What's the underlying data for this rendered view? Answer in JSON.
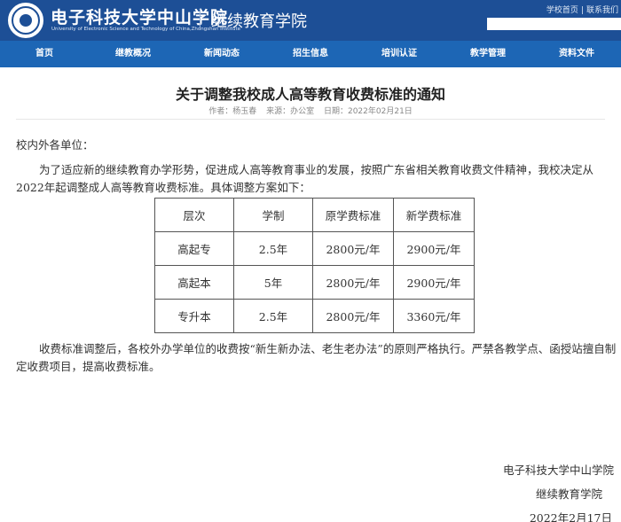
{
  "header": {
    "logo_cn": "电子科技大学中山学院",
    "logo_en": "University of Electronic Science and Technology of China,Zhongshan Institute",
    "subtitle": "继续教育学院",
    "links": [
      "学校首页",
      "联系我们"
    ],
    "link_separator": "|",
    "search_placeholder": ""
  },
  "nav": {
    "items": [
      "首页",
      "继教概况",
      "新闻动态",
      "招生信息",
      "培训认证",
      "教学管理",
      "资料文件"
    ]
  },
  "article": {
    "title": "关于调整我校成人高等教育收费标准的通知",
    "meta": {
      "author": "作者：杨玉春",
      "source": "来源：办公室",
      "date": "日期：2022年02月21日"
    },
    "greeting": "校内外各单位：",
    "para1": "为了适应新的继续教育办学形势，促进成人高等教育事业的发展，按照广东省相关教育收费文件精神，我校决定从2022年起调整成人高等教育收费标准。具体调整方案如下：",
    "table": {
      "headers": [
        "层次",
        "学制",
        "原学费标准",
        "新学费标准"
      ],
      "rows": [
        [
          "高起专",
          "2.5年",
          "2800元/年",
          "2900元/年"
        ],
        [
          "高起本",
          "5年",
          "2800元/年",
          "2900元/年"
        ],
        [
          "专升本",
          "2.5年",
          "2800元/年",
          "3360元/年"
        ]
      ]
    },
    "para2": "收费标准调整后，各校外办学单位的收费按“新生新办法、老生老办法”的原则严格执行。严禁各教学点、函授站擅自制定收费项目，提高收费标准。",
    "signature": {
      "org": "电子科技大学中山学院",
      "dept": "继续教育学院",
      "date": "2022年2月17日"
    }
  }
}
